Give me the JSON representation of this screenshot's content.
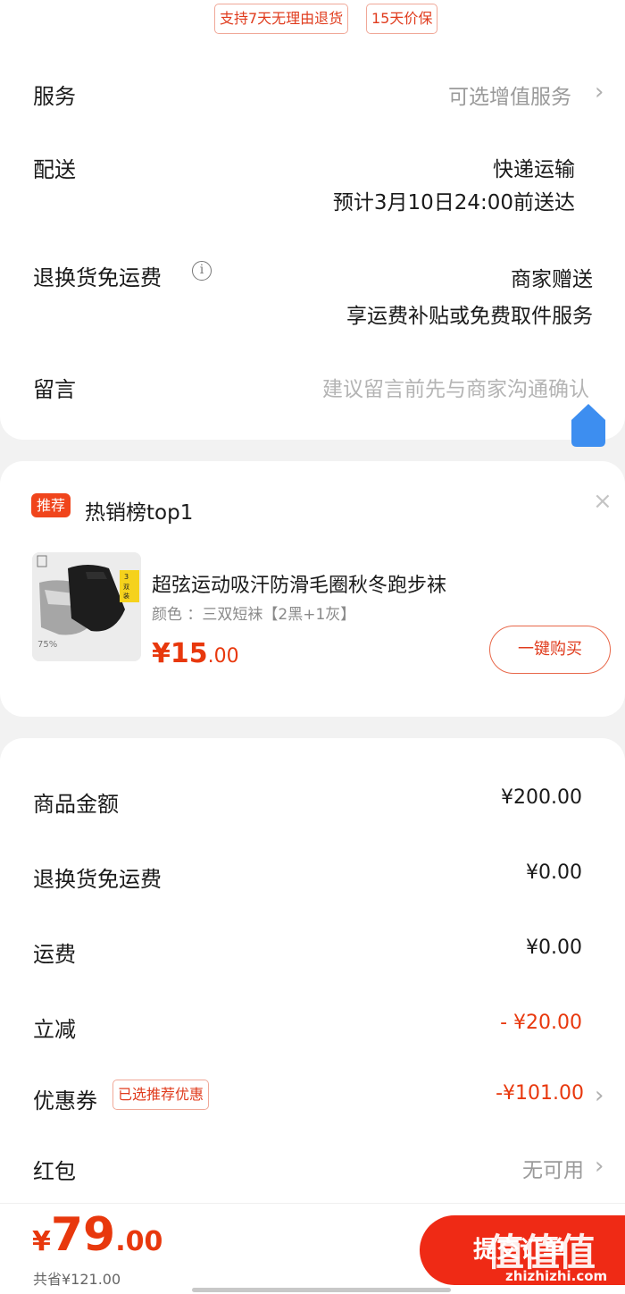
{
  "colors": {
    "accent": "#e8380d",
    "button": "#ef2a15",
    "float_button": "#3d8ef0"
  },
  "service_tags": [
    "支持7天无理由退货",
    "15天价保"
  ],
  "service": {
    "label": "服务",
    "value": "可选增值服务"
  },
  "delivery": {
    "label": "配送",
    "method": "快递运输",
    "eta": "预计3月10日24:00前送达"
  },
  "return_shipping": {
    "label": "退换货免运费",
    "value": "商家赠送",
    "detail": "享运费补贴或免费取件服务"
  },
  "message": {
    "label": "留言",
    "placeholder": "建议留言前先与商家沟通确认"
  },
  "recommend": {
    "badge": "推荐",
    "title": "热销榜top1",
    "product_name": "超弦运动吸汗防滑毛圈秋冬跑步袜",
    "spec": "颜色 ：三双短袜【2黑+1灰】",
    "price_int": "¥15",
    "price_dec": ".00",
    "buy_label": "一键购买",
    "image_badge": "3双装",
    "image_text": "75%"
  },
  "summary": {
    "goods": {
      "label": "商品金额",
      "value": "¥200.00"
    },
    "return_fee": {
      "label": "退换货免运费",
      "value": "¥0.00"
    },
    "shipping": {
      "label": "运费",
      "value": "¥0.00"
    },
    "discount": {
      "label": "立减",
      "value": "- ¥20.00"
    },
    "coupon": {
      "label": "优惠券",
      "tag": "已选推荐优惠",
      "value": "-¥101.00"
    },
    "red_packet": {
      "label": "红包",
      "value": "无可用"
    }
  },
  "bottom": {
    "currency": "¥",
    "total_int": "79",
    "total_dec": ".00",
    "saved": "共省¥121.00",
    "submit_label": "提交订单"
  },
  "watermark": {
    "text": "值值值",
    "url": "zhizhizhi.com"
  }
}
